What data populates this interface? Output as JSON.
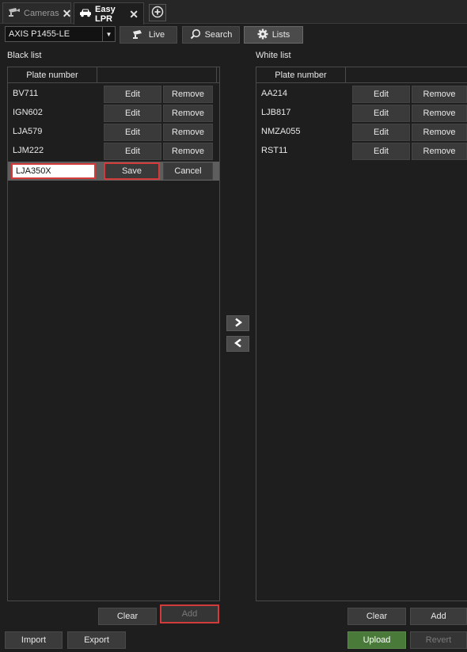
{
  "tabs": [
    {
      "label": "Cameras",
      "icon": "camera-icon"
    },
    {
      "label": "Easy LPR",
      "icon": "car-icon"
    }
  ],
  "toolbar": {
    "camera": "AXIS P1455-LE",
    "live_label": "Live",
    "search_label": "Search",
    "lists_label": "Lists"
  },
  "black_list": {
    "title": "Black list",
    "column": "Plate number",
    "rows": [
      {
        "plate": "BV711",
        "edit": "Edit",
        "remove": "Remove"
      },
      {
        "plate": "IGN602",
        "edit": "Edit",
        "remove": "Remove"
      },
      {
        "plate": "LJA579",
        "edit": "Edit",
        "remove": "Remove"
      },
      {
        "plate": "LJM222",
        "edit": "Edit",
        "remove": "Remove"
      }
    ],
    "editing": {
      "value": "LJA350X",
      "save": "Save",
      "cancel": "Cancel"
    },
    "clear_label": "Clear",
    "add_label": "Add"
  },
  "white_list": {
    "title": "White list",
    "column": "Plate number",
    "rows": [
      {
        "plate": "AA214",
        "edit": "Edit",
        "remove": "Remove"
      },
      {
        "plate": "LJB817",
        "edit": "Edit",
        "remove": "Remove"
      },
      {
        "plate": "NMZA055",
        "edit": "Edit",
        "remove": "Remove"
      },
      {
        "plate": "RST11",
        "edit": "Edit",
        "remove": "Remove"
      }
    ],
    "clear_label": "Clear",
    "add_label": "Add"
  },
  "footer": {
    "import_label": "Import",
    "export_label": "Export",
    "upload_label": "Upload",
    "revert_label": "Revert"
  },
  "colors": {
    "highlight": "#d33a3a",
    "upload": "#4a7a3a"
  }
}
